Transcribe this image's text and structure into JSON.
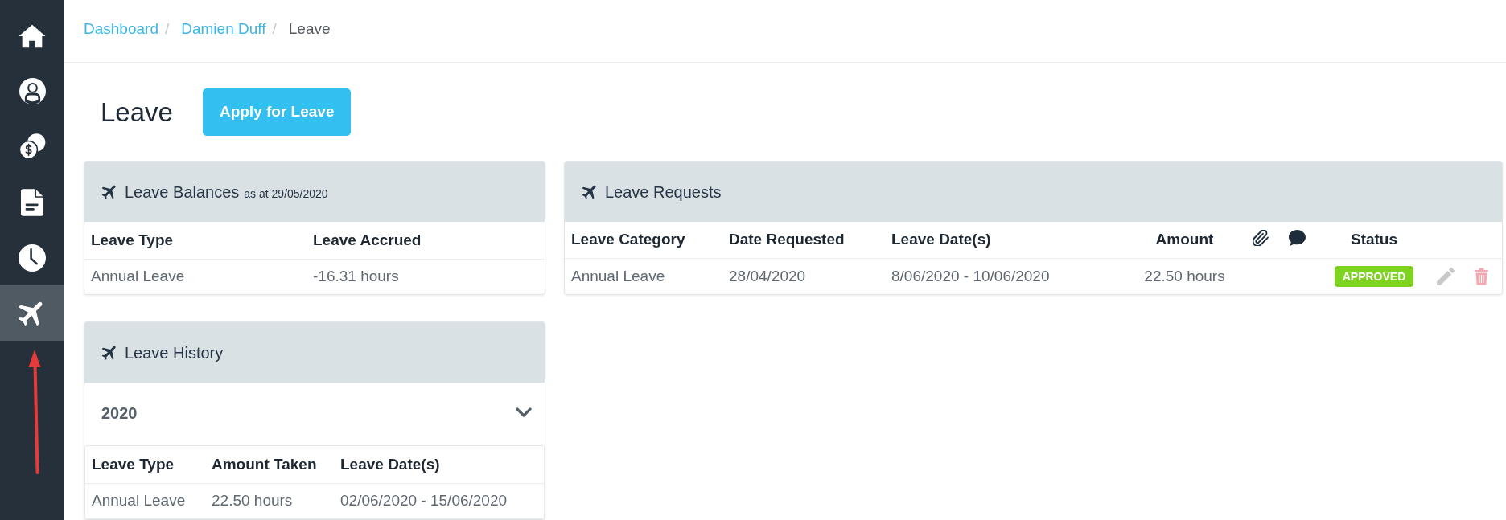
{
  "sidebar": {
    "items": [
      {
        "kind": "home",
        "selected": false
      },
      {
        "kind": "profile",
        "selected": false
      },
      {
        "kind": "money",
        "selected": false
      },
      {
        "kind": "document",
        "selected": false
      },
      {
        "kind": "clock",
        "selected": false
      },
      {
        "kind": "leave",
        "selected": true
      }
    ]
  },
  "breadcrumb": {
    "items": [
      {
        "label": "Dashboard",
        "current": false,
        "separator": "/"
      },
      {
        "label": "Damien Duff",
        "current": false,
        "separator": "/"
      },
      {
        "label": "Leave",
        "current": true
      }
    ]
  },
  "page": {
    "title": "Leave",
    "action_button": "Apply for Leave"
  },
  "leave_balances": {
    "title": "Leave Balances",
    "subtitle": "as at 29/05/2020",
    "columns": [
      "Leave Type",
      "Leave Accrued"
    ],
    "rows": [
      [
        "Annual Leave",
        "-16.31 hours"
      ]
    ]
  },
  "leave_history": {
    "title": "Leave History",
    "groups": [
      {
        "year": "2020",
        "expanded": true,
        "columns": [
          "Leave Type",
          "Amount Taken",
          "Leave Date(s)"
        ],
        "rows": [
          [
            "Annual Leave",
            "22.50 hours",
            "02/06/2020 - 15/06/2020"
          ]
        ]
      }
    ]
  },
  "leave_requests": {
    "title": "Leave Requests",
    "columns": [
      {
        "kind": "text",
        "label": "Leave Category"
      },
      {
        "kind": "text",
        "label": "Date Requested"
      },
      {
        "kind": "text",
        "label": "Leave Date(s)"
      },
      {
        "kind": "text",
        "label": "Amount"
      },
      {
        "kind": "attachment"
      },
      {
        "kind": "comment"
      },
      {
        "kind": "text",
        "label": "Status"
      }
    ],
    "rows": [
      {
        "cells": [
          "Annual Leave",
          "28/04/2020",
          "8/06/2020 - 10/06/2020",
          "22.50 hours"
        ],
        "status": {
          "label": "APPROVED",
          "color": "#7ed321"
        }
      }
    ]
  }
}
